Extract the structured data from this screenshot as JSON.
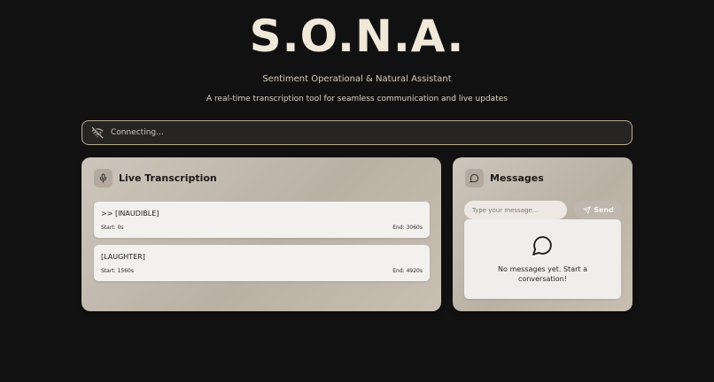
{
  "app": {
    "logo": "S.O.N.A.",
    "subtitle": "Sentiment Operational & Natural Assistant",
    "tagline": "A real-time transcription tool for seamless communication and live updates"
  },
  "status": {
    "icon": "wifi-off-icon",
    "text": "Connecting..."
  },
  "transcription": {
    "icon": "microphone-icon",
    "title": "Live Transcription",
    "entries": [
      {
        "text": ">> [INAUDIBLE]",
        "start": "Start: 0s",
        "end": "End: 3060s"
      },
      {
        "text": "[LAUGHTER]",
        "start": "Start: 1560s",
        "end": "End: 4920s"
      }
    ]
  },
  "messages": {
    "icon": "message-bubble-icon",
    "title": "Messages",
    "input_placeholder": "Type your message...",
    "input_value": "",
    "send_label": "Send",
    "send_icon": "send-icon",
    "empty_icon": "message-bubble-icon",
    "empty_text": "No messages yet. Start a conversation!"
  },
  "colors": {
    "background": "#121112",
    "card_gradient_start": "#cdc5bb",
    "card_gradient_end": "#bab1a5",
    "status_border": "#b8ab8f",
    "logo": "#f0e9da"
  }
}
